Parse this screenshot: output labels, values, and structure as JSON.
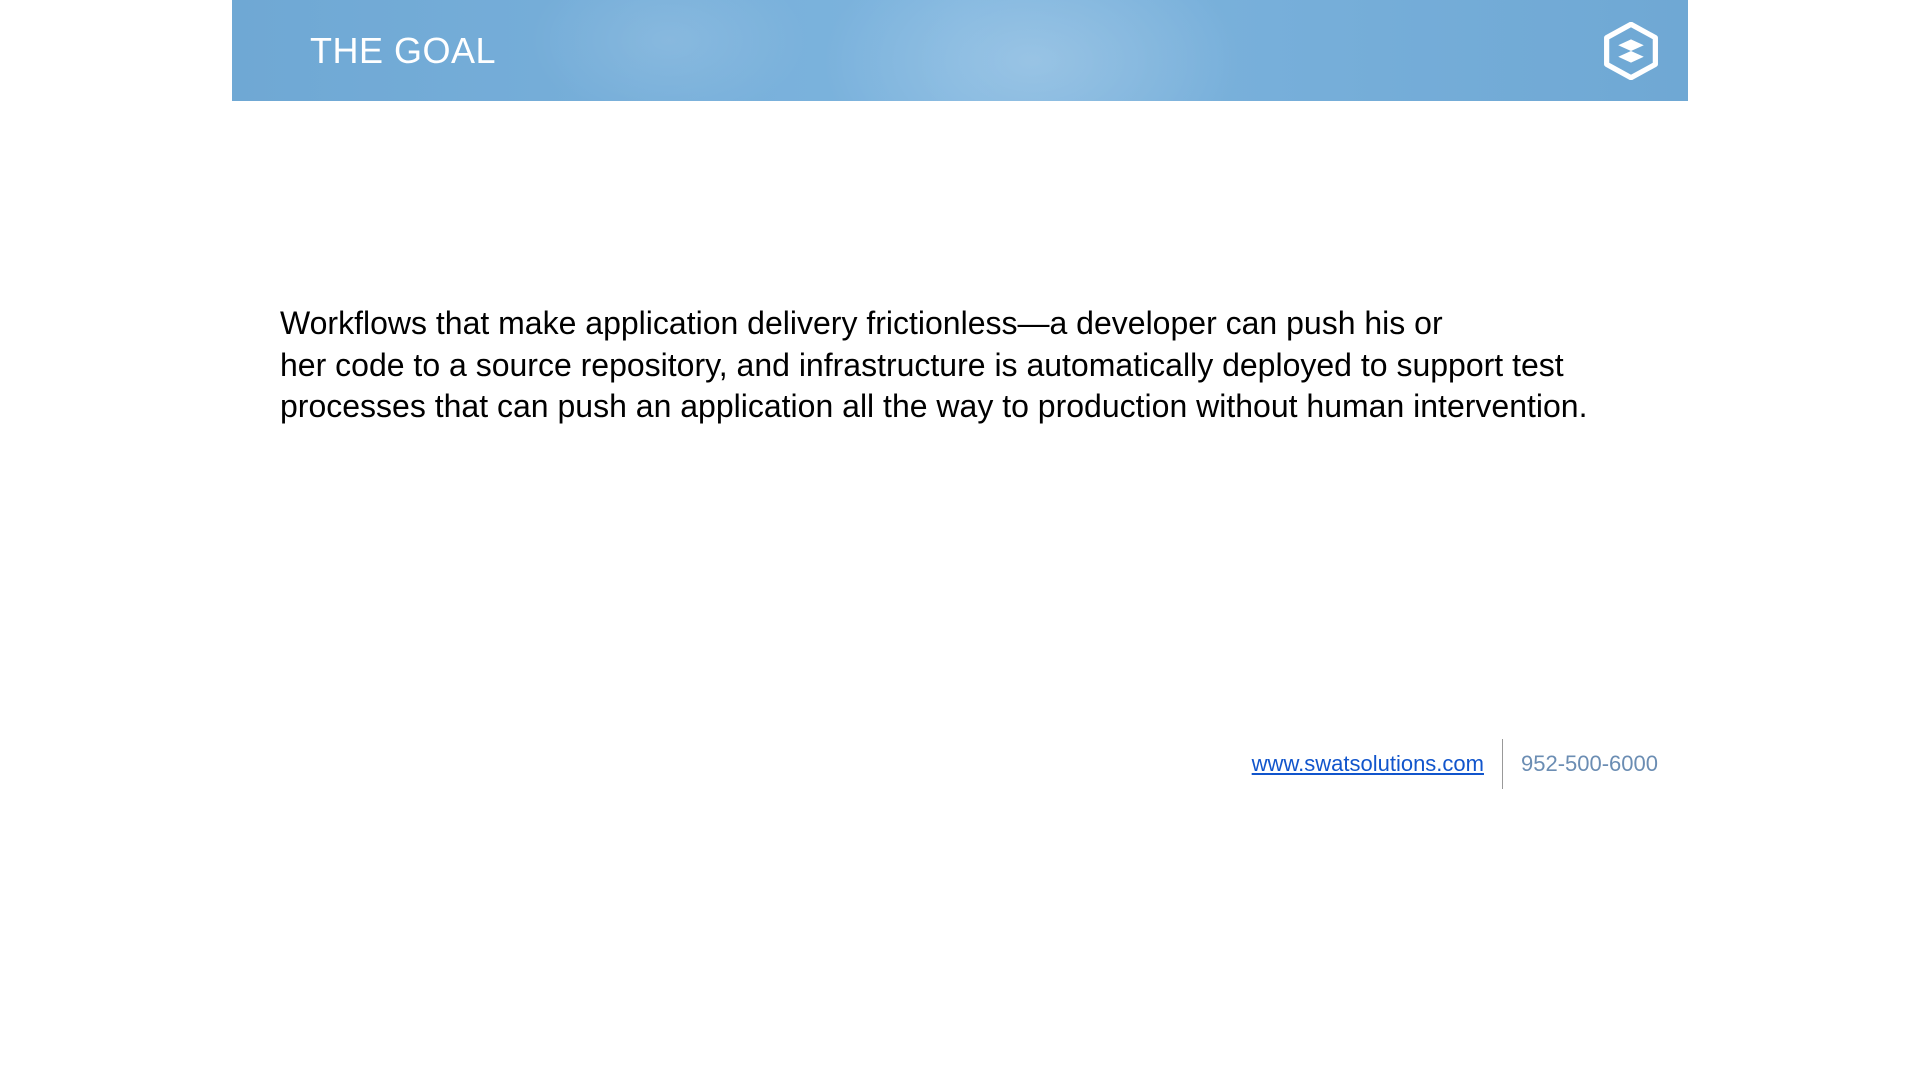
{
  "header": {
    "title": "THE GOAL",
    "logo_name": "swat-hex-logo"
  },
  "content": {
    "body": "Workflows that make application delivery frictionless—a developer can push his or\nher code to a source repository, and infrastructure is automatically deployed to support test processes that can push an application all the way to production without human intervention."
  },
  "footer": {
    "url": "www.swatsolutions.com",
    "phone": "952-500-6000"
  },
  "colors": {
    "header_bg": "#6fa8d4",
    "link": "#1155cc",
    "phone": "#6b8db3"
  }
}
